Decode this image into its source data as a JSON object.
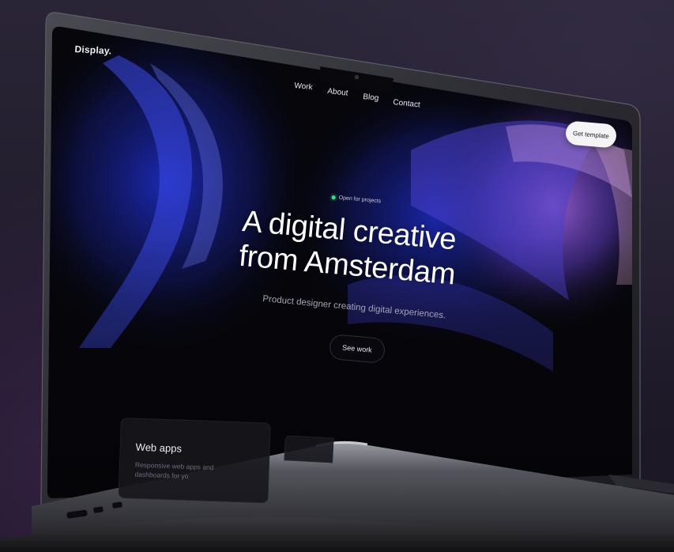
{
  "site": {
    "brand": "Display.",
    "nav": [
      {
        "label": "Work"
      },
      {
        "label": "About"
      },
      {
        "label": "Blog"
      },
      {
        "label": "Contact"
      }
    ],
    "cta_label": "Get template"
  },
  "hero": {
    "status": "Open for projects",
    "headline_line1": "A digital creative",
    "headline_line2": "from Amsterdam",
    "subhead": "Product designer creating digital experiences.",
    "button_label": "See work"
  },
  "cards": [
    {
      "title": "Web apps",
      "description": "Responsive web apps and dashboards for yo"
    }
  ],
  "colors": {
    "background": "#1c1826",
    "screen_base": "#07070c",
    "accent_blue": "#3a3fd8",
    "accent_purple": "#7a3fc0",
    "status_dot": "#3ddc84",
    "button_light": "#f4f4f6"
  }
}
